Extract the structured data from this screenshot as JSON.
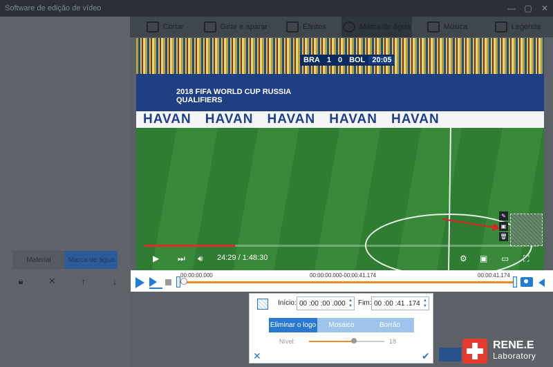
{
  "window": {
    "title": "Software de edição de vídeo",
    "controls": [
      "minimize",
      "maximize",
      "close"
    ]
  },
  "tabs": [
    {
      "label": "Cortar",
      "icon": "scissors-icon"
    },
    {
      "label": "Girar e aparar",
      "icon": "crop-icon"
    },
    {
      "label": "Efeitos",
      "icon": "effects-icon"
    },
    {
      "label": "Marca de água",
      "icon": "film-reel-icon",
      "active": true
    },
    {
      "label": "Música",
      "icon": "music-note-icon"
    },
    {
      "label": "Legenda",
      "icon": "subtitle-icon"
    }
  ],
  "left_panel": {
    "tabs": [
      {
        "label": "Material"
      },
      {
        "label": "Marca de água",
        "active": true
      }
    ],
    "tool_icons": [
      "lock-icon",
      "delete-icon",
      "move-up-icon",
      "move-down-icon"
    ]
  },
  "video": {
    "scoreboard": {
      "home": "BRA",
      "home_score": "1",
      "away_score": "0",
      "away": "BOL",
      "clock": "20:05"
    },
    "board_text": [
      "HAVAN",
      "HAVAN",
      "HAVAN",
      "HAVAN",
      "HAVAN"
    ],
    "banner_text": "2018 FIFA WORLD CUP RUSSIA\nQUALIFIERS",
    "player_time": "24:29 / 1:48:30",
    "player_progress": 0.23
  },
  "timeline": {
    "start": "00:00:00.000",
    "range": "00:00:00.000-00:00:41.174",
    "end": "00:00:41.174"
  },
  "edit_panel": {
    "start_label": "Início:",
    "start_value": "00 :00 :00 .000",
    "end_label": "Fim:",
    "end_value": "00 :00 :41 .174",
    "modes": [
      {
        "label": "Eliminar o logo",
        "active": true
      },
      {
        "label": "Mosaico"
      },
      {
        "label": "Borrão"
      }
    ],
    "level_label": "Nível:",
    "level_value": "18",
    "level_fraction": 0.6
  },
  "logo": {
    "line1": "RENE.E",
    "line2": "Laboratory"
  },
  "colors": {
    "accent": "#2a78d2",
    "timeline_bar": "#f08a1e",
    "progress": "#e32a2a",
    "arrow": "#e0211f"
  }
}
